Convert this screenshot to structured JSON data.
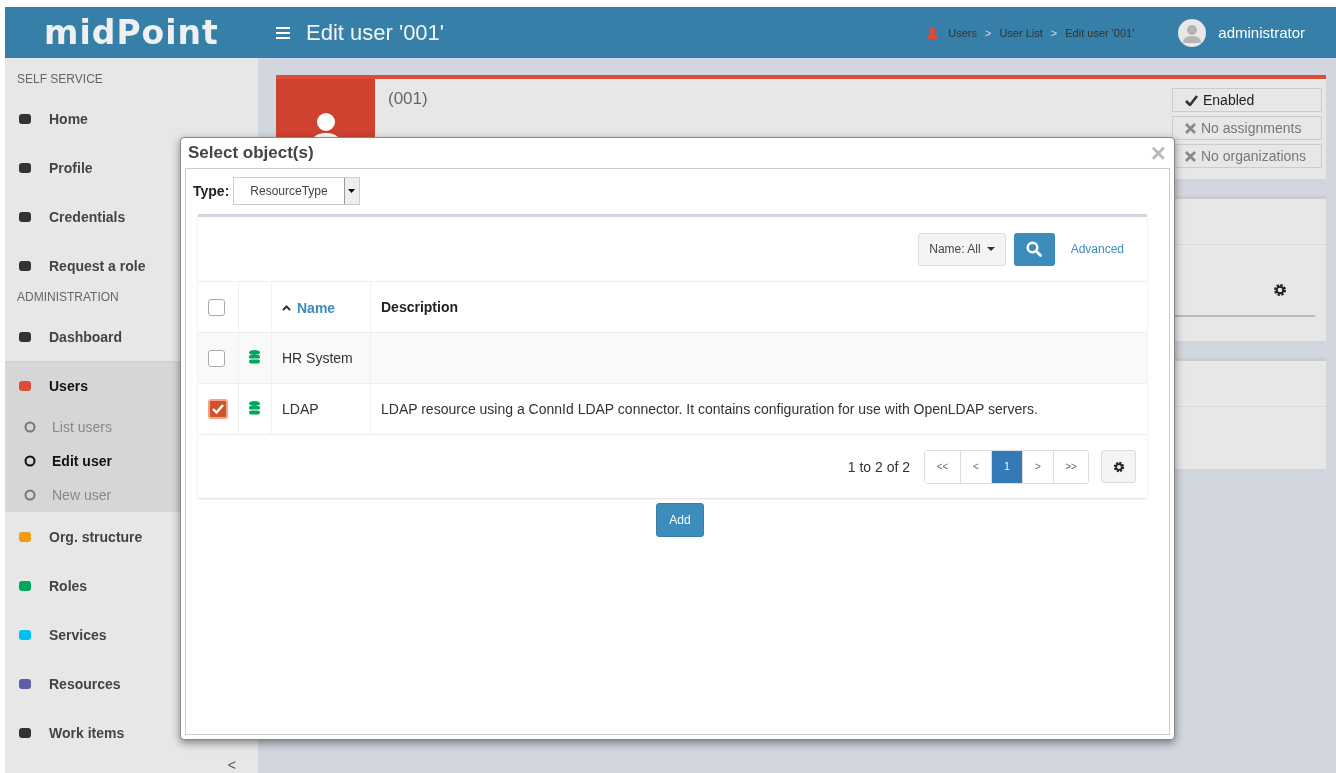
{
  "header": {
    "logo": "midPoint",
    "title": "Edit user '001'",
    "breadcrumbs": [
      {
        "label": "Users",
        "separator": ">"
      },
      {
        "label": "User List",
        "separator": ">"
      },
      {
        "label": "Edit user '001'"
      }
    ],
    "user": "administrator"
  },
  "sidebar": {
    "items": [
      {
        "kind": "section",
        "label": "SELF SERVICE"
      },
      {
        "kind": "item",
        "label": "Home",
        "selected": false
      },
      {
        "kind": "item",
        "label": "Profile",
        "selected": false
      },
      {
        "kind": "item",
        "label": "Credentials",
        "selected": false
      },
      {
        "kind": "item",
        "label": "Request a role",
        "selected": false
      },
      {
        "kind": "section",
        "label": "ADMINISTRATION"
      },
      {
        "kind": "item",
        "label": "Dashboard",
        "selected": false
      },
      {
        "kind": "item",
        "label": "Users",
        "selected": true,
        "expanded": true,
        "children": [
          {
            "label": "List users",
            "selected": false
          },
          {
            "label": "Edit user",
            "selected": true
          },
          {
            "label": "New user",
            "selected": false
          }
        ]
      },
      {
        "kind": "item",
        "label": "Org. structure",
        "selected": false
      },
      {
        "kind": "item",
        "label": "Roles",
        "selected": false
      },
      {
        "kind": "item",
        "label": "Services",
        "selected": false
      },
      {
        "kind": "item",
        "label": "Resources",
        "selected": false
      },
      {
        "kind": "item",
        "label": "Work items",
        "selected": false
      }
    ],
    "collapse": "<"
  },
  "profile": {
    "id": "(001)",
    "statuses": [
      {
        "label": "Enabled",
        "active": true
      },
      {
        "label": "No assignments",
        "active": false
      },
      {
        "label": "No organizations",
        "active": false
      }
    ]
  },
  "dialog": {
    "title": "Select object(s)",
    "close": "×",
    "type_label": "Type:",
    "type_value": "ResourceType",
    "filter": "Name: All",
    "advanced": "Advanced",
    "select_all": {
      "checked": false
    },
    "columns": [
      {
        "label": "Name",
        "sorted": true
      },
      {
        "label": "Description",
        "sorted": false
      }
    ],
    "rows": [
      {
        "name": "HR System",
        "checked": false
      },
      {
        "name": "LDAP",
        "description": "LDAP resource using a ConnId LDAP connector. It contains configuration for use with OpenLDAP servers.",
        "checked": true
      }
    ],
    "summary": "1 to 2 of 2",
    "pages": [
      {
        "label": "<<",
        "selected": false
      },
      {
        "label": "<",
        "selected": false
      },
      {
        "label": "1",
        "selected": true
      },
      {
        "label": ">",
        "selected": false
      },
      {
        "label": ">>",
        "selected": false
      }
    ],
    "add": "Add"
  }
}
